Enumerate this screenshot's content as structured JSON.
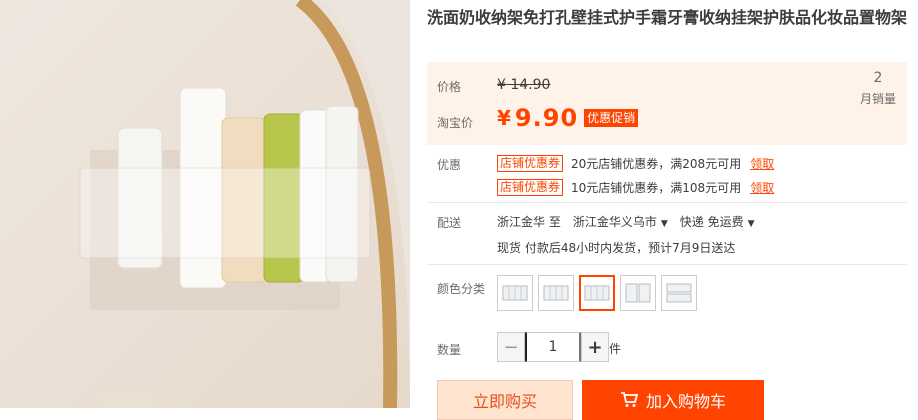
{
  "product": {
    "title": "洗面奶收纳架免打孔壁挂式护手霜牙膏收纳挂架护肤品化妆品置物架",
    "image_alt": "product-photo"
  },
  "price": {
    "label": "价格",
    "original": "¥ 14.90",
    "promo_label": "淘宝价",
    "currency": "¥",
    "current": "9.90",
    "promo_badge": "优惠促销",
    "sales_count": "2",
    "sales_label": "月销量"
  },
  "coupons": {
    "label": "优惠",
    "items": [
      {
        "tag": "店铺优惠券",
        "desc": "20元店铺优惠券，满208元可用",
        "action": "领取"
      },
      {
        "tag": "店铺优惠券",
        "desc": "10元店铺优惠券，满108元可用",
        "action": "领取"
      }
    ]
  },
  "shipping": {
    "label": "配送",
    "from": "浙江金华 至",
    "to": "浙江金华义乌市",
    "method": "快递 免运费",
    "note": "现货 付款后48小时内发货，预计7月9日送达"
  },
  "color": {
    "label": "颜色分类",
    "selected_index": 2,
    "option_count": 5
  },
  "quantity": {
    "label": "数量",
    "value": "1",
    "unit": "件",
    "minus": "−",
    "plus": "+"
  },
  "actions": {
    "buy_now": "立即购买",
    "add_to_cart": "加入购物车"
  },
  "colors": {
    "accent": "#ff4400",
    "price_bg": "#fff2e8",
    "buy_bg": "#ffe4d0"
  }
}
